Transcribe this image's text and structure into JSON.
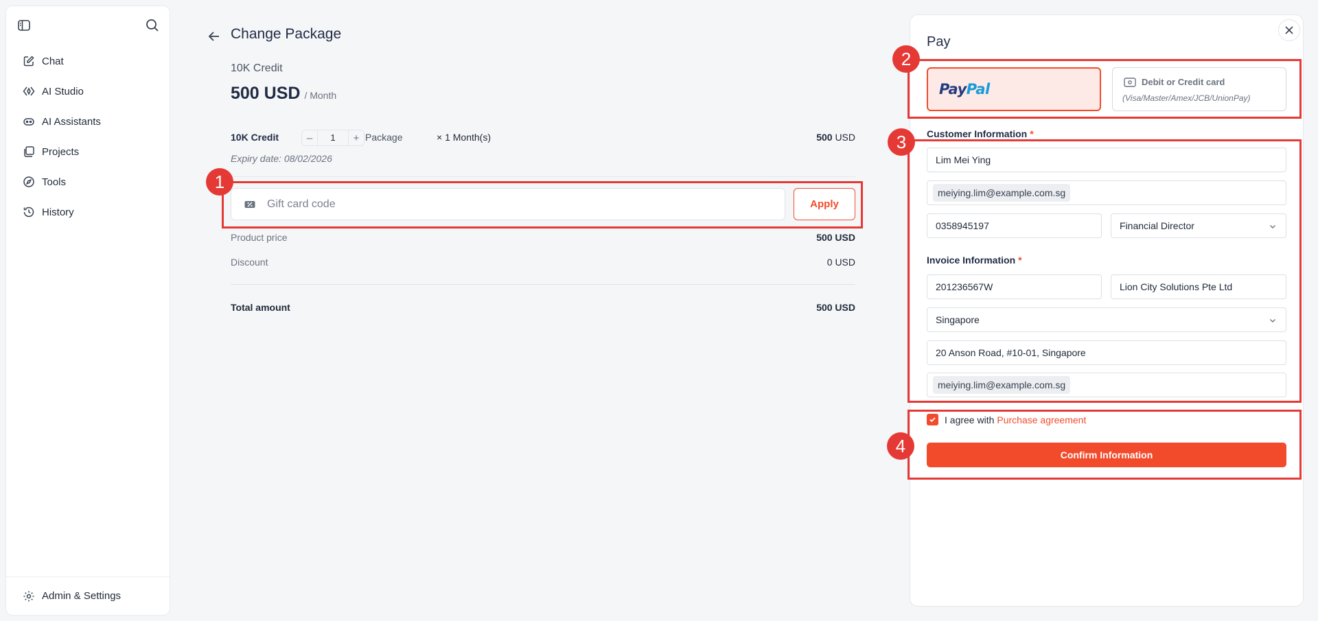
{
  "sidebar": {
    "items": [
      {
        "label": "Chat",
        "icon": "edit-square-icon"
      },
      {
        "label": "AI Studio",
        "icon": "studio-icon"
      },
      {
        "label": "AI Assistants",
        "icon": "bot-icon"
      },
      {
        "label": "Projects",
        "icon": "folders-icon"
      },
      {
        "label": "Tools",
        "icon": "compass-icon"
      },
      {
        "label": "History",
        "icon": "history-icon"
      }
    ],
    "settings_label": "Admin & Settings"
  },
  "main": {
    "title": "Change Package",
    "package_name": "10K Credit",
    "price_amount": "500 USD",
    "price_period": "/ Month",
    "line": {
      "name": "10K Credit",
      "quantity": "1",
      "unit": "Package",
      "months": "×  1 Month(s)",
      "total_value": "500",
      "total_currency": "USD"
    },
    "expiry": "Expiry date: 08/02/2026",
    "gift_placeholder": "Gift card code",
    "apply_label": "Apply",
    "product_price_label": "Product price",
    "product_price_value": "500 USD",
    "discount_label": "Discount",
    "discount_value": "0 USD",
    "total_label": "Total amount",
    "total_value": "500 USD"
  },
  "pay": {
    "title": "Pay",
    "paypal_part1": "Pay",
    "paypal_part2": "Pal",
    "card_title": "Debit or Credit card",
    "card_subtitle": "(Visa/Master/Amex/JCB/UnionPay)",
    "customer_label": "Customer Information",
    "customer_name": "Lim Mei Ying",
    "customer_email": "meiying.lim@example.com.sg",
    "customer_phone": "0358945197",
    "customer_position": "Financial Director",
    "invoice_label": "Invoice Information",
    "tax_code": "201236567W",
    "company": "Lion City Solutions Pte Ltd",
    "country": "Singapore",
    "address": "20 Anson Road, #10-01, Singapore",
    "invoice_email": "meiying.lim@example.com.sg",
    "agree_text": "I agree with",
    "agree_link": "Purchase agreement",
    "confirm_label": "Confirm Information",
    "required_mark": "*"
  },
  "annotations": [
    "1",
    "2",
    "3",
    "4"
  ],
  "colors": {
    "accent": "#f24b2c",
    "annotation": "#e53935",
    "paypal_dark": "#253b80",
    "paypal_light": "#179bd7"
  }
}
